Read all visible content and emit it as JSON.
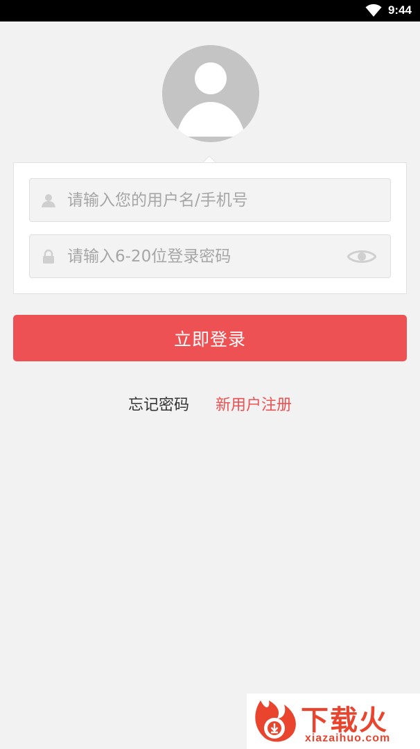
{
  "status_bar": {
    "time": "9:44",
    "wifi_icon": "wifi-icon"
  },
  "avatar": {
    "icon": "default-avatar-icon"
  },
  "login_form": {
    "username": {
      "placeholder": "请输入您的用户名/手机号",
      "value": "",
      "icon": "user-icon"
    },
    "password": {
      "placeholder": "请输入6-20位登录密码",
      "value": "",
      "icon": "lock-icon",
      "toggle_icon": "eye-icon"
    },
    "submit_label": "立即登录"
  },
  "links": {
    "forgot_password": "忘记密码",
    "register": "新用户注册"
  },
  "watermark": {
    "brand_cn": "下载火",
    "brand_en": "xiazaihuo.com"
  },
  "colors": {
    "accent": "#ed5153",
    "background": "#f2f2f2",
    "status_bar": "#000000"
  }
}
